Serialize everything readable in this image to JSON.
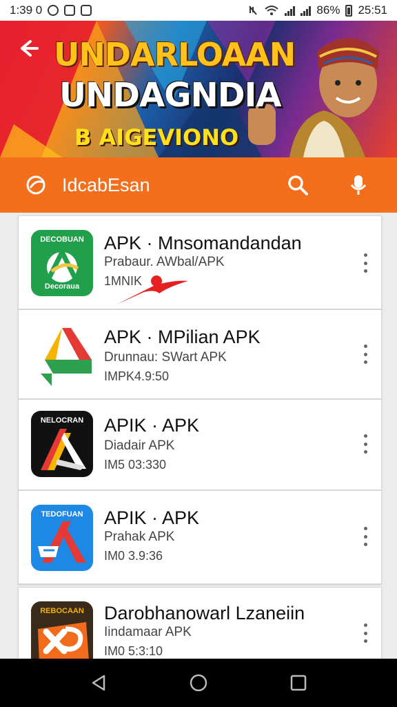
{
  "status_bar": {
    "time": "1:39 0",
    "battery": "86%",
    "clock": "25:51"
  },
  "banner": {
    "title_line1": "UNDARLOAAN",
    "title_line2": "UNDAGNDIA",
    "subtitle": "B AIGEVIONO"
  },
  "search": {
    "text": "IdcabEsan"
  },
  "apps": [
    {
      "title": "APK · Mnsomandandan",
      "developer": "Prabaur. AWbal/APK",
      "meta": "1MNIK",
      "icon_label": "DECOBUAN",
      "icon_label_bottom": "Decoraua",
      "icon_bg": "#20a04a"
    },
    {
      "title": "APK · MPilian APK",
      "developer": "Drunnau: SWart APK",
      "meta": "IMPK4.9:50",
      "icon_label": "",
      "icon_bg": "#ffffff"
    },
    {
      "title": "APIK · APK",
      "developer": "Diadair APK",
      "meta": "IM5 03:330",
      "icon_label": "NELOCRAN",
      "icon_bg": "#111111"
    },
    {
      "title": "APIK · APK",
      "developer": "Prahak APK",
      "meta": "IM0 3.9:36",
      "icon_label": "TEDOFUAN",
      "icon_bg": "#1e88e5"
    },
    {
      "title": "Darobhanowarl Lzaneiin",
      "developer": "Iindamaar APK",
      "meta": "IM0 5:3:10",
      "icon_label": "REBOCAAN",
      "icon_bg": "#3a2a1a"
    }
  ],
  "colors": {
    "accent": "#f36f1c",
    "nav_bg": "#000000"
  },
  "icons": {
    "back": "arrow-left-icon",
    "logo": "swirl-logo-icon",
    "search": "search-icon",
    "mic": "microphone-icon",
    "more": "more-vertical-icon",
    "nav_back": "triangle-back-icon",
    "nav_home": "circle-home-icon",
    "nav_recents": "square-recents-icon"
  }
}
